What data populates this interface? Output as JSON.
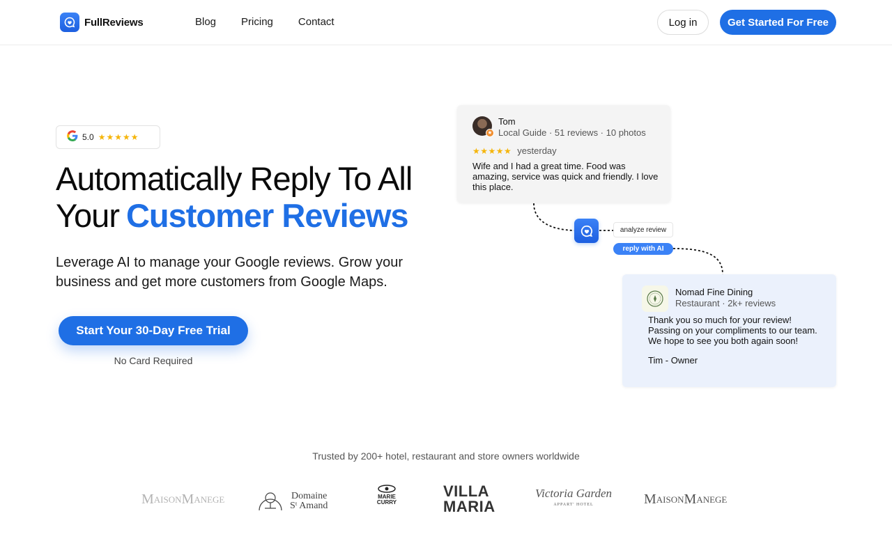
{
  "header": {
    "brand": "FullReviews",
    "nav": [
      "Blog",
      "Pricing",
      "Contact"
    ],
    "login_label": "Log in",
    "cta_label": "Get Started For Free"
  },
  "hero": {
    "rating": "5.0",
    "stars": "★★★★★",
    "title_line1": "Automatically Reply To All",
    "title_line2_plain": "Your",
    "title_line2_accent": "Customer Reviews",
    "subtitle": "Leverage AI to manage your Google reviews. Grow your business and get more customers from Google Maps.",
    "trial_button": "Start Your 30-Day Free Trial",
    "no_card": "No Card Required"
  },
  "review": {
    "name": "Tom",
    "meta": "Local Guide · 51 reviews · 10 photos",
    "stars": "★★★★★",
    "date": "yesterday",
    "text": "Wife and I had a great time. Food was amazing, service was quick and friendly. I love this place."
  },
  "flow": {
    "analyze": "analyze review",
    "reply": "reply with AI"
  },
  "reply": {
    "business": "Nomad Fine Dining",
    "meta": "Restaurant · 2k+ reviews",
    "text": "Thank you so much for your review! Passing on your compliments to our team. We hope to see you both again soon!",
    "sign": "Tim - Owner"
  },
  "trusted": {
    "text": "Trusted by 200+ hotel, restaurant and store owners worldwide",
    "brands": {
      "maison1_a": "M",
      "maison1_b": "AISON",
      "maison1_c": "M",
      "maison1_d": "ANEGE",
      "domaine_1": "Domaine",
      "domaine_2": "Sᵗ Amand",
      "marie_1": "MARIE",
      "marie_2": "CURRY",
      "villa_1": "VILLA",
      "villa_2": "MARIA",
      "victoria_1": "Victoria Garden",
      "victoria_2": "APPART' HOTEL",
      "maison2_a": "M",
      "maison2_b": "AISON",
      "maison2_c": "M",
      "maison2_d": "ANEGE"
    }
  },
  "colors": {
    "accent": "#1f6fe5",
    "star": "#f5b50a",
    "reply_bg": "#ebf1fc"
  }
}
